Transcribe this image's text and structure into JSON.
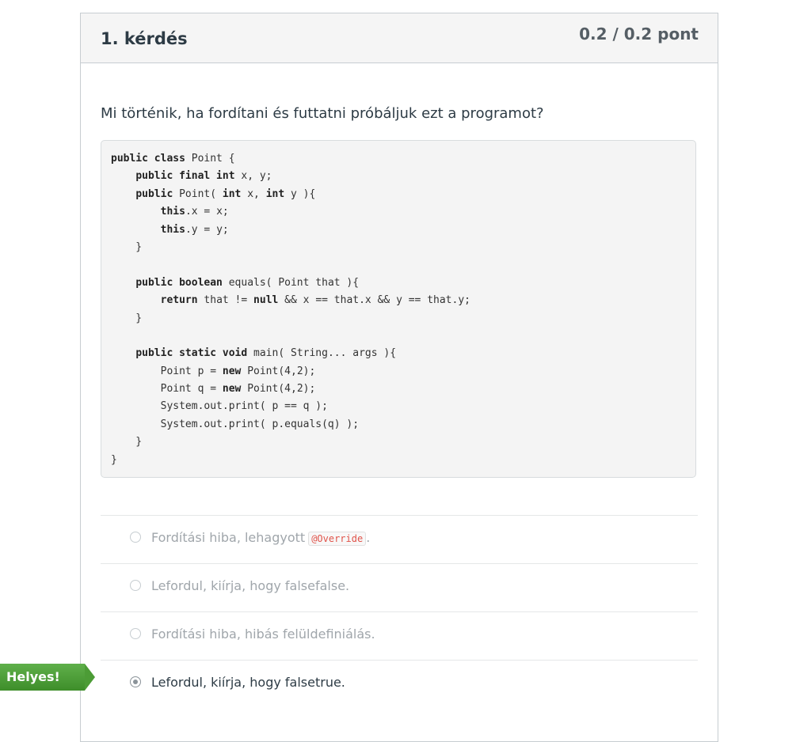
{
  "question": {
    "title": "1. kérdés",
    "points": "0.2 / 0.2 pont",
    "text": "Mi történik, ha fordítani és futtatni próbáljuk ezt a programot?"
  },
  "code": [
    [
      {
        "k": "public class"
      },
      {
        "t": " Point {"
      }
    ],
    [
      {
        "t": "    "
      },
      {
        "k": "public final int"
      },
      {
        "t": " x, y;"
      }
    ],
    [
      {
        "t": "    "
      },
      {
        "k": "public"
      },
      {
        "t": " Point( "
      },
      {
        "k": "int"
      },
      {
        "t": " x, "
      },
      {
        "k": "int"
      },
      {
        "t": " y ){"
      }
    ],
    [
      {
        "t": "        "
      },
      {
        "k": "this"
      },
      {
        "t": ".x = x;"
      }
    ],
    [
      {
        "t": "        "
      },
      {
        "k": "this"
      },
      {
        "t": ".y = y;"
      }
    ],
    [
      {
        "t": "    }"
      }
    ],
    [
      {
        "t": ""
      }
    ],
    [
      {
        "t": "    "
      },
      {
        "k": "public boolean"
      },
      {
        "t": " equals( Point that ){"
      }
    ],
    [
      {
        "t": "        "
      },
      {
        "k": "return"
      },
      {
        "t": " that != "
      },
      {
        "k": "null"
      },
      {
        "t": " && x == that.x && y == that.y;"
      }
    ],
    [
      {
        "t": "    }"
      }
    ],
    [
      {
        "t": ""
      }
    ],
    [
      {
        "t": "    "
      },
      {
        "k": "public static void"
      },
      {
        "t": " main( String... args ){"
      }
    ],
    [
      {
        "t": "        Point p = "
      },
      {
        "k": "new"
      },
      {
        "t": " Point(4,2);"
      }
    ],
    [
      {
        "t": "        Point q = "
      },
      {
        "k": "new"
      },
      {
        "t": " Point(4,2);"
      }
    ],
    [
      {
        "t": "        System.out.print( p == q );"
      }
    ],
    [
      {
        "t": "        System.out.print( p.equals(q) );"
      }
    ],
    [
      {
        "t": "    }"
      }
    ],
    [
      {
        "t": "}"
      }
    ]
  ],
  "answers": [
    {
      "text": "Fordítási hiba, lehagyott",
      "code": "@Override",
      "suffix": ".",
      "selected": false
    },
    {
      "text": "Lefordul, kiírja, hogy falsefalse.",
      "selected": false
    },
    {
      "text": "Fordítási hiba, hibás felüldefiniálás.",
      "selected": false
    },
    {
      "text": "Lefordul, kiírja, hogy falsetrue.",
      "selected": true
    }
  ],
  "feedback": {
    "correct_label": "Helyes!",
    "color": "#4c9c36"
  }
}
